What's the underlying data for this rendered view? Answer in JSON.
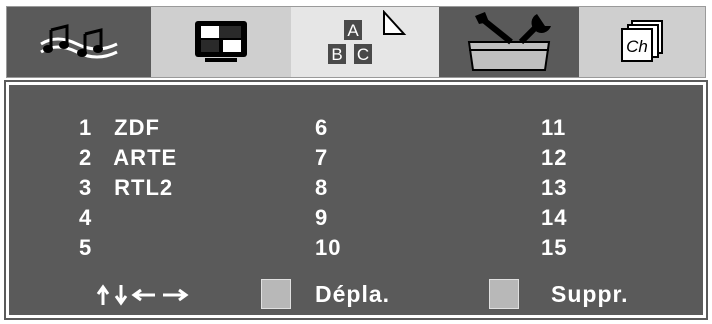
{
  "menu": {
    "tabs": [
      {
        "icon": "music-notes-icon",
        "state": "dark"
      },
      {
        "icon": "picture-tv-icon",
        "state": "light"
      },
      {
        "icon": "abc-letters-icon",
        "state": "selected",
        "letters": [
          "A",
          "B",
          "C"
        ]
      },
      {
        "icon": "tools-box-icon",
        "state": "dark"
      },
      {
        "icon": "channel-pages-icon",
        "state": "light",
        "label": "Ch"
      }
    ]
  },
  "channels": {
    "col1": [
      {
        "num": "1",
        "name": "ZDF"
      },
      {
        "num": "2",
        "name": "ARTE"
      },
      {
        "num": "3",
        "name": "RTL2"
      },
      {
        "num": "4",
        "name": ""
      },
      {
        "num": "5",
        "name": ""
      }
    ],
    "col2": [
      {
        "num": "6",
        "name": ""
      },
      {
        "num": "7",
        "name": ""
      },
      {
        "num": "8",
        "name": ""
      },
      {
        "num": "9",
        "name": ""
      },
      {
        "num": "10",
        "name": ""
      }
    ],
    "col3": [
      {
        "num": "11",
        "name": ""
      },
      {
        "num": "12",
        "name": ""
      },
      {
        "num": "13",
        "name": ""
      },
      {
        "num": "14",
        "name": ""
      },
      {
        "num": "15",
        "name": ""
      }
    ]
  },
  "footer": {
    "arrows": "↑↓←→",
    "move_label": "Dépla.",
    "delete_label": "Suppr."
  },
  "colors": {
    "panel_bg": "#5a5a5a",
    "tab_light": "#cfcfcf",
    "tab_selected": "#e6e6e6",
    "text": "#ffffff",
    "key_button": "#b8b8b8"
  }
}
